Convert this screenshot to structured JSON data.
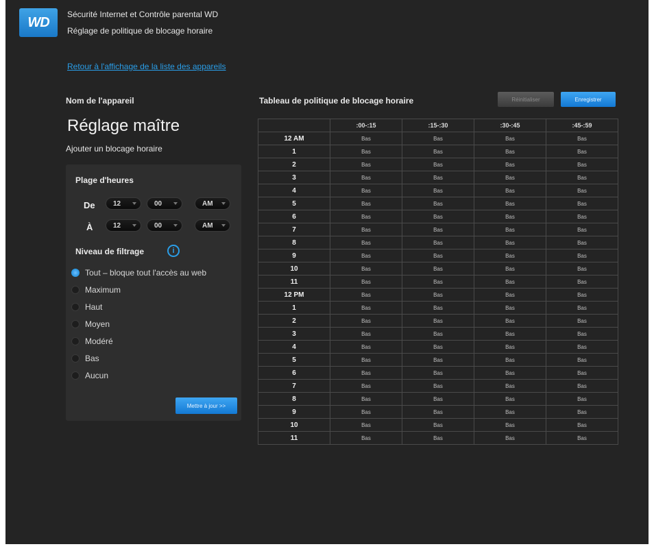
{
  "header": {
    "logo": "WD",
    "title": "Sécurité Internet et Contrôle parental WD",
    "subtitle": "Réglage de politique de blocage horaire",
    "back_link": "Retour à l'affichage de la liste des appareils"
  },
  "device": {
    "label": "Nom de l'appareil",
    "name": "Réglage maître"
  },
  "panel": {
    "add_block": "Ajouter un blocage horaire",
    "time_range_title": "Plage d'heures",
    "from_label": "De",
    "to_label": "À",
    "from": {
      "hour": "12",
      "minute": "00",
      "ampm": "AM"
    },
    "to": {
      "hour": "12",
      "minute": "00",
      "ampm": "AM"
    },
    "filter_title": "Niveau de filtrage",
    "options": [
      {
        "label": "Tout – bloque tout l'accès au web",
        "selected": true
      },
      {
        "label": "Maximum",
        "selected": false
      },
      {
        "label": "Haut",
        "selected": false
      },
      {
        "label": "Moyen",
        "selected": false
      },
      {
        "label": "Modéré",
        "selected": false
      },
      {
        "label": "Bas",
        "selected": false
      },
      {
        "label": "Aucun",
        "selected": false
      }
    ],
    "update_button": "Mettre à jour >>"
  },
  "table": {
    "title": "Tableau de politique de blocage horaire",
    "reset_button": "Réinitialiser",
    "save_button": "Enregistrer",
    "columns": [
      "",
      ":00-:15",
      ":15-:30",
      ":30-:45",
      ":45-:59"
    ],
    "rows": [
      {
        "hour": "12 AM",
        "cells": [
          "Bas",
          "Bas",
          "Bas",
          "Bas"
        ]
      },
      {
        "hour": "1",
        "cells": [
          "Bas",
          "Bas",
          "Bas",
          "Bas"
        ]
      },
      {
        "hour": "2",
        "cells": [
          "Bas",
          "Bas",
          "Bas",
          "Bas"
        ]
      },
      {
        "hour": "3",
        "cells": [
          "Bas",
          "Bas",
          "Bas",
          "Bas"
        ]
      },
      {
        "hour": "4",
        "cells": [
          "Bas",
          "Bas",
          "Bas",
          "Bas"
        ]
      },
      {
        "hour": "5",
        "cells": [
          "Bas",
          "Bas",
          "Bas",
          "Bas"
        ]
      },
      {
        "hour": "6",
        "cells": [
          "Bas",
          "Bas",
          "Bas",
          "Bas"
        ]
      },
      {
        "hour": "7",
        "cells": [
          "Bas",
          "Bas",
          "Bas",
          "Bas"
        ]
      },
      {
        "hour": "8",
        "cells": [
          "Bas",
          "Bas",
          "Bas",
          "Bas"
        ]
      },
      {
        "hour": "9",
        "cells": [
          "Bas",
          "Bas",
          "Bas",
          "Bas"
        ]
      },
      {
        "hour": "10",
        "cells": [
          "Bas",
          "Bas",
          "Bas",
          "Bas"
        ]
      },
      {
        "hour": "11",
        "cells": [
          "Bas",
          "Bas",
          "Bas",
          "Bas"
        ]
      },
      {
        "hour": "12 PM",
        "cells": [
          "Bas",
          "Bas",
          "Bas",
          "Bas"
        ]
      },
      {
        "hour": "1",
        "cells": [
          "Bas",
          "Bas",
          "Bas",
          "Bas"
        ]
      },
      {
        "hour": "2",
        "cells": [
          "Bas",
          "Bas",
          "Bas",
          "Bas"
        ]
      },
      {
        "hour": "3",
        "cells": [
          "Bas",
          "Bas",
          "Bas",
          "Bas"
        ]
      },
      {
        "hour": "4",
        "cells": [
          "Bas",
          "Bas",
          "Bas",
          "Bas"
        ]
      },
      {
        "hour": "5",
        "cells": [
          "Bas",
          "Bas",
          "Bas",
          "Bas"
        ]
      },
      {
        "hour": "6",
        "cells": [
          "Bas",
          "Bas",
          "Bas",
          "Bas"
        ]
      },
      {
        "hour": "7",
        "cells": [
          "Bas",
          "Bas",
          "Bas",
          "Bas"
        ]
      },
      {
        "hour": "8",
        "cells": [
          "Bas",
          "Bas",
          "Bas",
          "Bas"
        ]
      },
      {
        "hour": "9",
        "cells": [
          "Bas",
          "Bas",
          "Bas",
          "Bas"
        ]
      },
      {
        "hour": "10",
        "cells": [
          "Bas",
          "Bas",
          "Bas",
          "Bas"
        ]
      },
      {
        "hour": "11",
        "cells": [
          "Bas",
          "Bas",
          "Bas",
          "Bas"
        ]
      }
    ]
  },
  "colors": {
    "background": "#242424",
    "accent": "#2a9ee8",
    "text": "#e6e6e6"
  }
}
